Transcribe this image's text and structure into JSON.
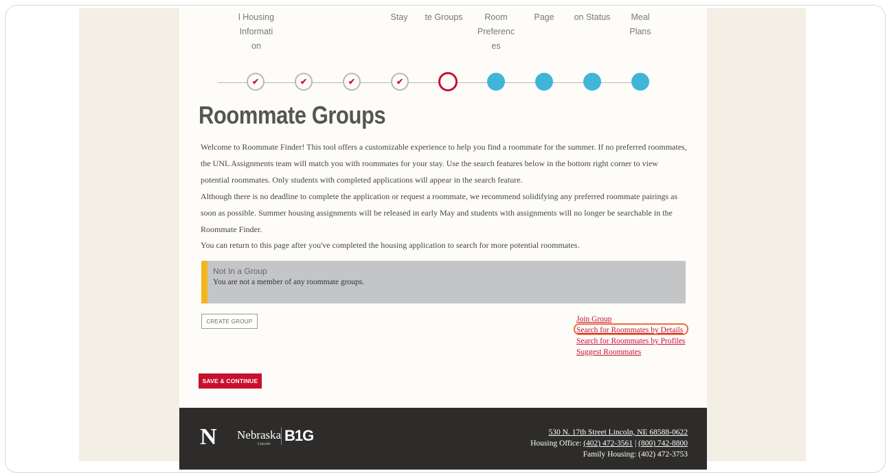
{
  "steps": {
    "labels": [
      "l Housing\nInformati\non",
      "Stay",
      "te Groups",
      "Room\nPreferenc\nes",
      "Page",
      "on Status",
      "Meal\nPlans"
    ],
    "check_glyph": "✔"
  },
  "page": {
    "title": "Roommate Groups",
    "paragraph1": "Welcome to Roommate Finder! This tool offers a customizable experience to help you find a roommate for the summer. If no preferred roommates, the UNL Assignments team will match you with roommates for your stay. Use the search features below in the bottom right corner to view potential roommates. Only students with completed applications will appear in the search feature.",
    "paragraph2": "Although there is no deadline to complete the application or request a roommate, we recommend solidifying any preferred roommate pairings as soon as possible. Summer housing assignments will be released in early May and students with assignments will no longer be searchable in the Roommate Finder.",
    "paragraph3": "You can return to this page after you've completed the housing application to search for more potential roommates."
  },
  "group_status": {
    "title": "Not In a Group",
    "text": "You are not a member of any roommate groups."
  },
  "buttons": {
    "create_group": "CREATE GROUP",
    "save_continue": "SAVE & CONTINUE"
  },
  "links": {
    "join_group": "Join Group",
    "search_details": "Search for Roommates by Details",
    "search_profiles": "Search for Roommates by Profiles",
    "suggest": "Suggest Roommates"
  },
  "footer": {
    "logo_n": "N",
    "logo_nebraska": "Nebraska",
    "logo_lincoln": "Lincoln",
    "logo_big": "B1G",
    "address": "530 N. 17th Street Lincoln, NE 68588-0622",
    "housing_office_label": "Housing Office: ",
    "phone1": "(402) 472-3561",
    "phone_sep": " | ",
    "phone2": "(800) 742-8800",
    "family_housing": "Family Housing: (402) 472-3753"
  },
  "colors": {
    "accent_red": "#c8102e",
    "step_future": "#40b5d8",
    "highlight": "#ef6a3a",
    "group_bar": "#f5b41a"
  }
}
